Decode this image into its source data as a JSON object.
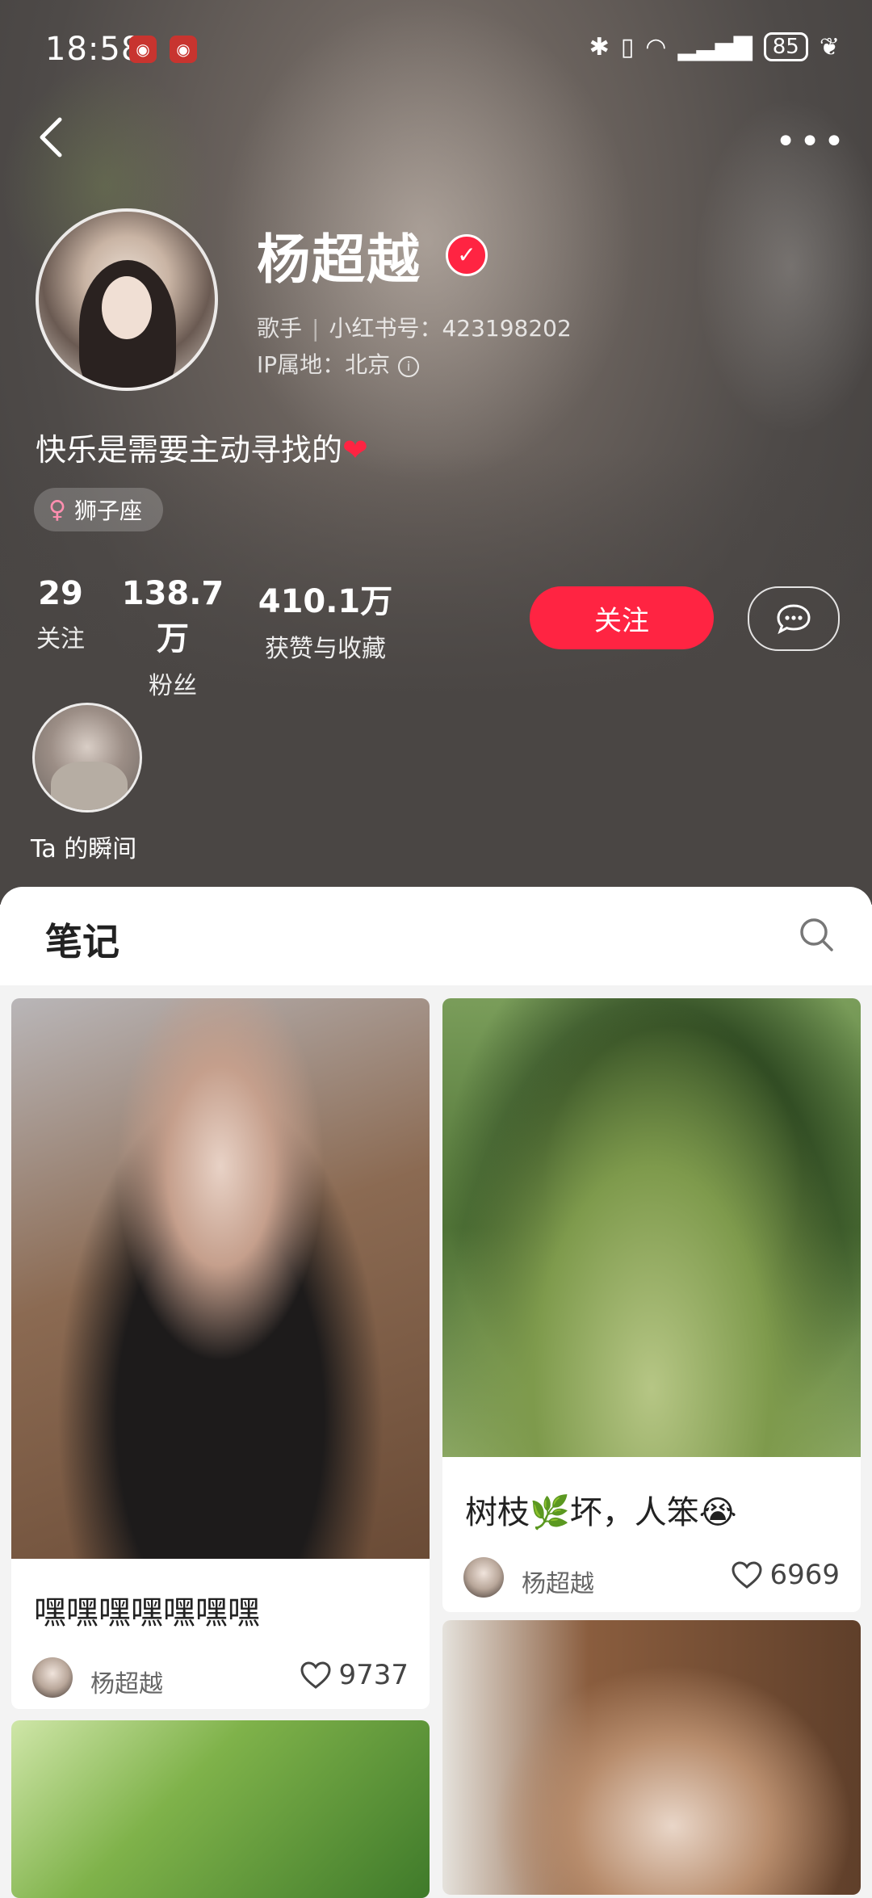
{
  "status_bar": {
    "time": "18:58",
    "battery": "85"
  },
  "profile": {
    "name": "杨超越",
    "role": "歌手",
    "id_label": "小红书号：423198202",
    "ip_label": "IP属地：北京",
    "bio": "快乐是需要主动寻找的",
    "bio_emoji": "❤",
    "tag": "狮子座"
  },
  "stats": [
    {
      "value": "29",
      "label": "关注"
    },
    {
      "value": "138.7万",
      "label": "粉丝"
    },
    {
      "value": "410.1万",
      "label": "获赞与收藏"
    }
  ],
  "actions": {
    "follow": "关注"
  },
  "moments": {
    "label": "Ta 的瞬间"
  },
  "tabs": {
    "notes": "笔记"
  },
  "feed": [
    {
      "title": "嘿嘿嘿嘿嘿嘿嘿",
      "author": "杨超越",
      "likes": "9737"
    },
    {
      "title": "树枝🌿坏，人笨😭",
      "author": "杨超越",
      "likes": "6969"
    }
  ],
  "colors": {
    "accent": "#ff2442",
    "header_bg": "#4a4644"
  }
}
